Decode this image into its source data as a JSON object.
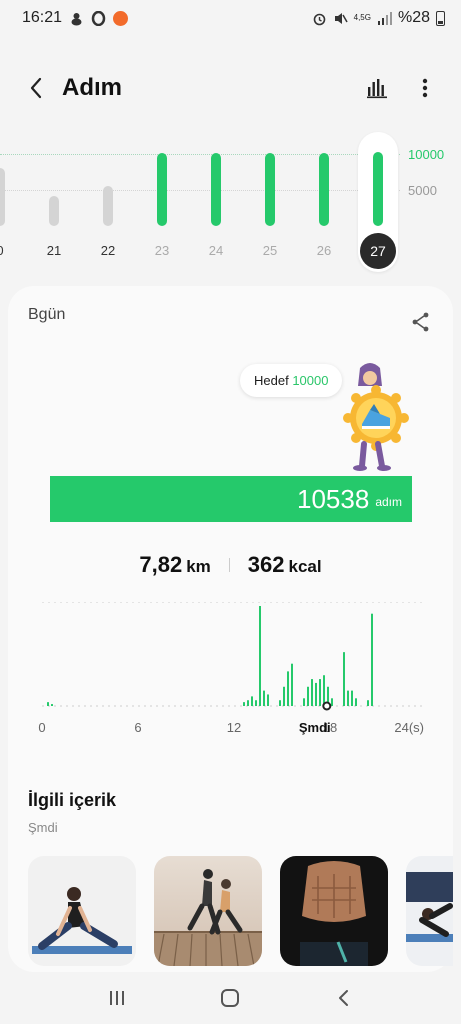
{
  "status_bar": {
    "time": "16:21",
    "network": "4,5G",
    "battery_text": "%28"
  },
  "header": {
    "title": "Adım"
  },
  "week_chart": {
    "goal_label": "10000",
    "mid_label": "5000",
    "days": [
      {
        "label": "0",
        "value": 8000,
        "state": "past"
      },
      {
        "label": "21",
        "value": 4200,
        "state": "past"
      },
      {
        "label": "22",
        "value": 5600,
        "state": "past"
      },
      {
        "label": "23",
        "value": 10100,
        "state": "goal"
      },
      {
        "label": "24",
        "value": 10100,
        "state": "goal"
      },
      {
        "label": "25",
        "value": 10100,
        "state": "goal"
      },
      {
        "label": "26",
        "value": 10100,
        "state": "goal"
      },
      {
        "label": "27",
        "value": 10538,
        "state": "selected"
      }
    ]
  },
  "today": {
    "subtitle": "Bgün",
    "goal_prefix": "Hedef",
    "goal_value": "10000",
    "steps": "10538",
    "steps_unit": "adım",
    "distance_value": "7,82",
    "distance_unit": "km",
    "calories_value": "362",
    "calories_unit": "kcal"
  },
  "hourly_chart": {
    "x_ticks": [
      "0",
      "6",
      "12",
      "18",
      "24(s)"
    ],
    "now_label": "Şmdi",
    "now_hour": 17.8,
    "values": [
      0,
      2,
      1,
      0,
      0,
      0,
      0,
      0,
      0,
      0,
      0,
      0,
      0,
      0,
      0,
      0,
      0,
      0,
      0,
      0,
      0,
      0,
      0,
      0,
      0,
      0,
      0,
      0,
      0,
      0,
      0,
      0,
      0,
      0,
      0,
      0,
      0,
      0,
      0,
      0,
      0,
      0,
      0,
      0,
      0,
      0,
      0,
      0,
      0,
      0,
      2,
      3,
      5,
      3,
      52,
      8,
      6,
      0,
      0,
      3,
      10,
      18,
      22,
      0,
      0,
      4,
      10,
      14,
      12,
      14,
      16,
      10,
      4,
      0,
      0,
      28,
      8,
      8,
      4,
      0,
      0,
      3,
      48,
      0,
      0,
      0,
      0,
      0,
      0,
      0,
      0,
      0,
      0,
      0,
      0,
      0
    ]
  },
  "related": {
    "title": "İlgili içerik",
    "subtitle": "Şmdi",
    "items": [
      {
        "name": "stretching-workout"
      },
      {
        "name": "running-couple"
      },
      {
        "name": "abs-workout"
      },
      {
        "name": "yoga-pose"
      }
    ]
  },
  "colors": {
    "accent_green": "#25c96b",
    "past_bar": "#d4d4d4",
    "text_dark": "#111111"
  }
}
